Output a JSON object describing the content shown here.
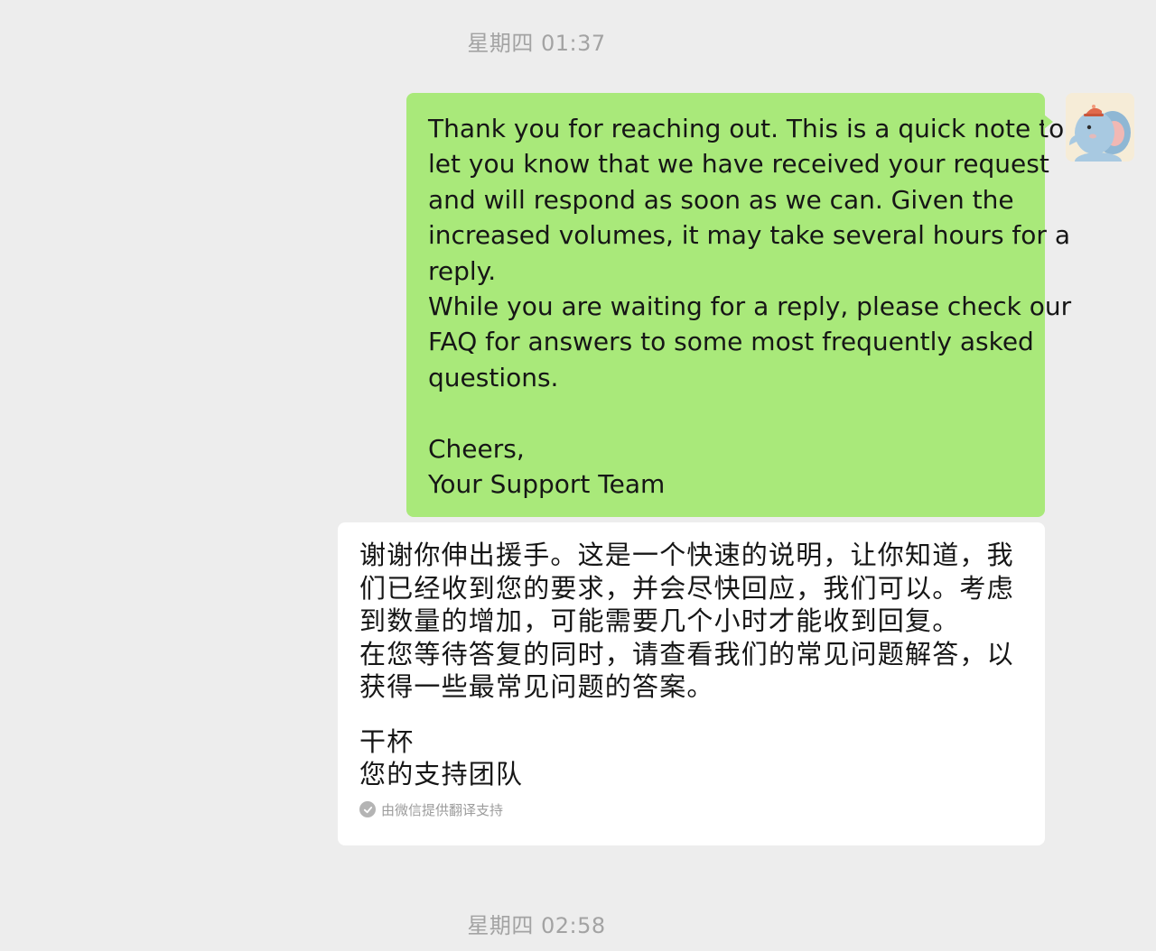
{
  "timestamps": [
    "星期四 01:37",
    "星期四 02:58"
  ],
  "message": {
    "lines": [
      "Thank you for reaching out. This is a quick note to",
      "let you know that we have received your request",
      "and will respond as soon as we can. Given the",
      "increased volumes, it may take several hours for a",
      "reply.",
      "While you are waiting for a reply, please check our",
      "FAQ for answers to some most frequently asked",
      "questions.",
      "",
      "Cheers,",
      "Your Support Team"
    ],
    "bubble_color": "#a9e97a"
  },
  "translation": {
    "lines": [
      "谢谢你伸出援手。这是一个快速的说明，让你知道，我",
      "们已经收到您的要求，并会尽快回应，我们可以。考虑",
      "到数量的增加，可能需要几个小时才能收到回复。",
      "在您等待答复的同时，请查看我们的常见问题解答，以",
      "获得一些最常见问题的答案。"
    ],
    "signoff": [
      "干杯",
      "您的支持团队"
    ],
    "provider": "由微信提供翻译支持"
  },
  "avatar": {
    "icon": "elephant-avatar-icon"
  }
}
